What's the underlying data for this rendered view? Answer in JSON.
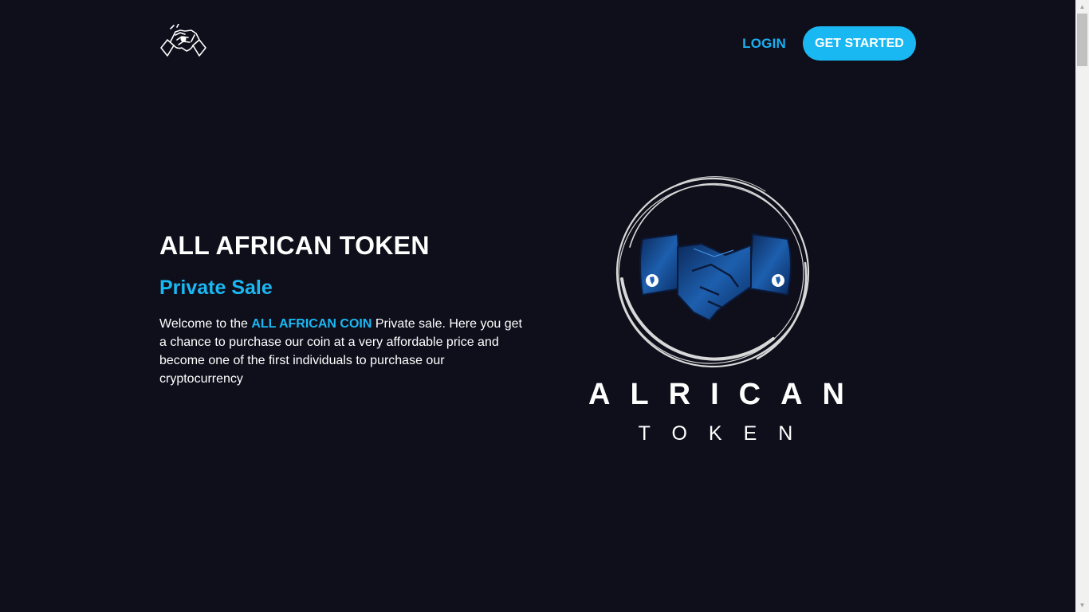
{
  "header": {
    "login_label": "LOGIN",
    "get_started_label": "GET STARTED"
  },
  "hero": {
    "title": "ALL AFRICAN TOKEN",
    "subtitle": "Private Sale",
    "desc_prefix": "Welcome to the ",
    "desc_highlight": "ALL AFRICAN COIN",
    "desc_suffix": " Private sale. Here you get a chance to purchase our coin at a very affordable price and become one of the first individuals to purchase our cryptocurrency"
  },
  "brand": {
    "word1": "ALRICAN",
    "word2": "TOKEN"
  },
  "icons": {
    "header_logo": "handshake-fist-logo-icon",
    "hero_logo": "handshake-circle-logo-icon"
  },
  "colors": {
    "background": "#0f0f1c",
    "accent": "#1ab8f2",
    "text": "#ffffff"
  }
}
